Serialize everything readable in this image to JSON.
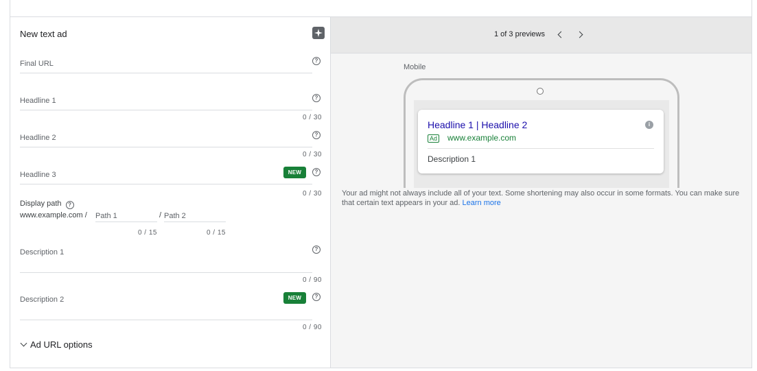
{
  "editor": {
    "title": "New text ad",
    "final_url": {
      "label": "Final URL"
    },
    "headline1": {
      "label": "Headline 1",
      "counter": "0 / 30"
    },
    "headline2": {
      "label": "Headline 2",
      "counter": "0 / 30"
    },
    "headline3": {
      "label": "Headline 3",
      "counter": "0 / 30",
      "badge": "NEW"
    },
    "display_path": {
      "label": "Display path",
      "domain": "www.example.com /",
      "path1_placeholder": "Path 1",
      "path1_counter": "0 / 15",
      "slash": "/",
      "path2_placeholder": "Path 2",
      "path2_counter": "0 / 15"
    },
    "description1": {
      "label": "Description 1",
      "counter": "0 / 90"
    },
    "description2": {
      "label": "Description 2",
      "counter": "0 / 90",
      "badge": "NEW"
    },
    "url_options": "Ad URL options"
  },
  "preview": {
    "count": "1 of 3 previews",
    "device_label": "Mobile",
    "ad": {
      "headline": "Headline 1 | Headline 2",
      "badge": "Ad",
      "url": "www.example.com",
      "description": "Description 1",
      "info_icon": "i"
    },
    "disclaimer": "Your ad might not always include all of your text. Some shortening may also occur in some formats. You can make sure that certain text appears in your ad.",
    "learn_more": "Learn more"
  },
  "icons": {
    "help": "?",
    "ai": "sparkle-icon"
  },
  "colors": {
    "link": "#1a0dab",
    "accent": "#1a73e8",
    "badge_green": "#188038"
  }
}
